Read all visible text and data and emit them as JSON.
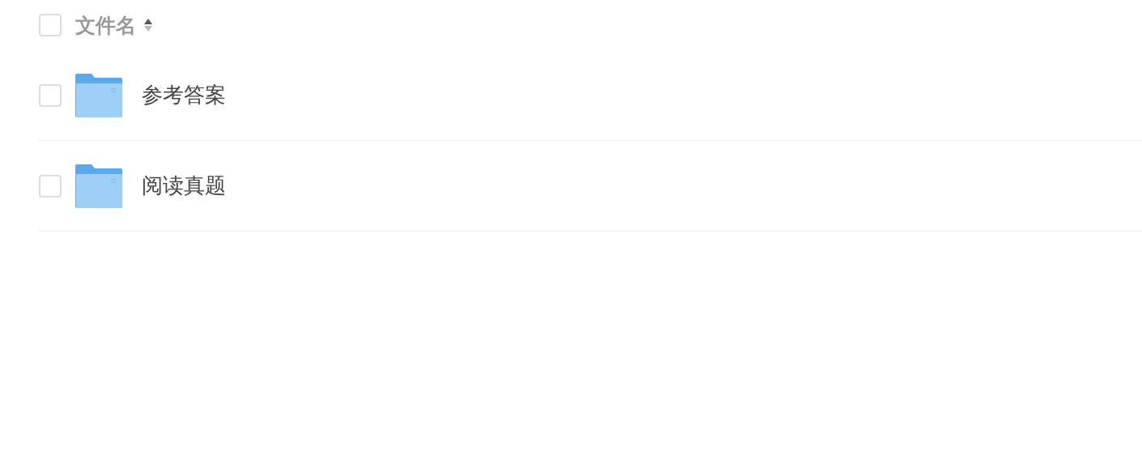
{
  "header": {
    "checked": false,
    "label": "文件名",
    "sort_ascending": true
  },
  "files": [
    {
      "name": "参考答案",
      "kind": "folder",
      "checked": false
    },
    {
      "name": "阅读真题",
      "kind": "folder",
      "checked": false
    }
  ]
}
